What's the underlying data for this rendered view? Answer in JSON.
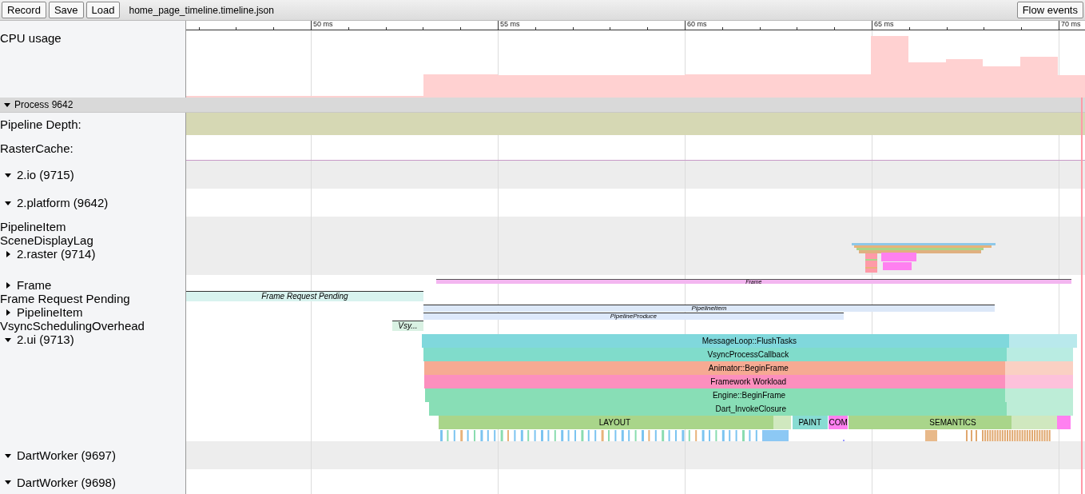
{
  "toolbar": {
    "buttons": [
      "Record",
      "Save",
      "Load"
    ],
    "file_name": "home_page_timeline.timeline.json",
    "flow_events_button": "Flow events"
  },
  "ruler": {
    "ticks": [
      "50 ms",
      "55 ms",
      "60 ms",
      "65 ms",
      "70 ms"
    ]
  },
  "tracks": [
    {
      "kind": "cpu",
      "label": "CPU usage"
    },
    {
      "kind": "process",
      "label": "Process 9642",
      "expanded": true
    },
    {
      "kind": "counter",
      "label": "Pipeline Depth:"
    },
    {
      "kind": "marker",
      "label": "RasterCache:"
    },
    {
      "kind": "thread",
      "label": "2.io (9715)",
      "expanded": true
    },
    {
      "kind": "thread",
      "label": "2.platform (9642)",
      "expanded": true
    },
    {
      "kind": "group",
      "has_overview": true,
      "lines": [
        {
          "text": "PipelineItem"
        },
        {
          "text": "SceneDisplayLag"
        },
        {
          "text": "2.raster (9714)",
          "expanded": false
        }
      ]
    },
    {
      "kind": "group",
      "lines": [
        {
          "text": "Frame",
          "expanded": false
        },
        {
          "text": "Frame Request Pending"
        },
        {
          "text": "PipelineItem",
          "expanded": false
        },
        {
          "text": "VsyncSchedulingOverhead"
        },
        {
          "text": "2.ui (9713)",
          "expanded": true
        }
      ],
      "lanes": [
        {
          "kind": "async_thin",
          "slices": [
            {
              "label": "Frame",
              "color": "#f3b6f0"
            }
          ]
        },
        {
          "kind": "async",
          "slices": [
            {
              "label": "Frame Request Pending",
              "color": "#d8f3ef"
            }
          ]
        },
        {
          "kind": "async_half",
          "slices": [
            {
              "label": "PipelineItem",
              "color": "#dce8f8"
            }
          ]
        },
        {
          "kind": "async_half",
          "slices": [
            {
              "label": "PipelineProduce",
              "color": "#dde9fb"
            }
          ]
        },
        {
          "kind": "async",
          "slices": [
            {
              "label": "Vsy...",
              "color": "#d9f1e3"
            }
          ]
        },
        {
          "kind": "sync",
          "slices": [
            {
              "label": "MessageLoop::FlushTasks",
              "color": "#80d8dc"
            }
          ]
        },
        {
          "kind": "sync",
          "slices": [
            {
              "label": "VsyncProcessCallback",
              "color": "#80dccb"
            }
          ]
        },
        {
          "kind": "sync",
          "slices": [
            {
              "label": "Animator::BeginFrame",
              "color": "#f6aa93"
            }
          ]
        },
        {
          "kind": "sync",
          "slices": [
            {
              "label": "Framework Workload",
              "color": "#fc8fbe"
            }
          ]
        },
        {
          "kind": "sync",
          "slices": [
            {
              "label": "Engine::BeginFrame",
              "color": "#88deb6"
            }
          ]
        },
        {
          "kind": "sync",
          "slices": [
            {
              "label": "Dart_InvokeClosure",
              "color": "#88deb6"
            }
          ]
        },
        {
          "kind": "sync",
          "slices": [
            {
              "label": "LAYOUT",
              "color": "#a9d58a"
            },
            {
              "label": "PAINT",
              "color": "#88dcd3"
            },
            {
              "label": "COM",
              "color": "#ff80f0"
            },
            {
              "label": "SEMANTICS",
              "color": "#a9d58a"
            },
            {
              "color": "#ff80f0"
            }
          ]
        },
        {
          "kind": "marks"
        }
      ]
    },
    {
      "kind": "thread",
      "label": "DartWorker (9697)",
      "expanded": true
    },
    {
      "kind": "thread",
      "label": "DartWorker (9698)",
      "expanded": true
    }
  ]
}
